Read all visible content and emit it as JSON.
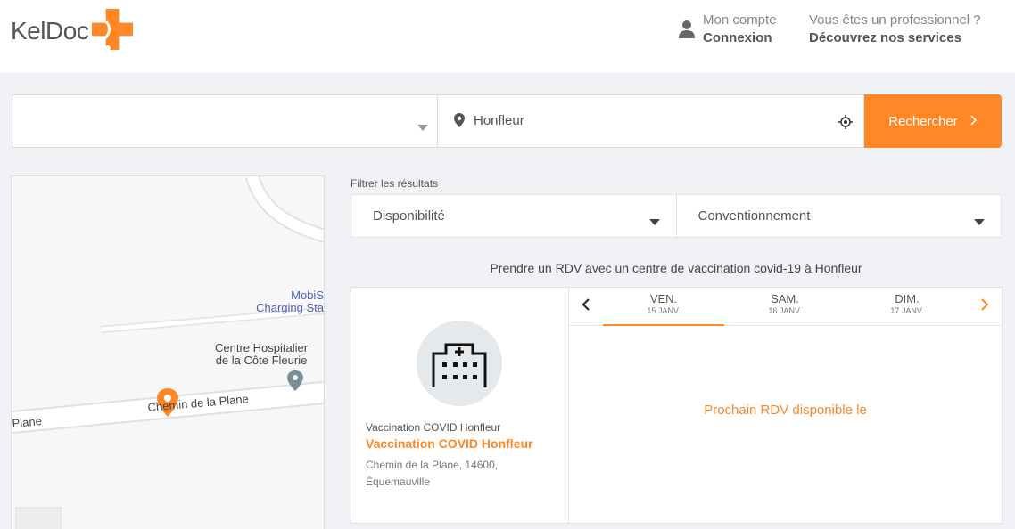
{
  "header": {
    "logo_text": "KelDoc",
    "account_line1": "Mon compte",
    "account_line2": "Connexion",
    "pro_line1": "Vous êtes un professionnel ?",
    "pro_line2": "Découvrez nos services"
  },
  "search": {
    "specialty_value": "",
    "location_value": "Honfleur",
    "button_label": "Rechercher"
  },
  "map": {
    "poi1_line1": "MobiS",
    "poi1_line2": "Charging Sta",
    "poi2_line1": "Centre Hospitalier",
    "poi2_line2": "de la Côte Fleurie",
    "road_label": "Chemin de la Plane",
    "road_label_left": "Plane"
  },
  "filters": {
    "label": "Filtrer les résultats",
    "availability": "Disponibilité",
    "convention": "Conventionnement"
  },
  "results": {
    "title": "Prendre un RDV avec un centre de vaccination covid-19 à Honfleur",
    "practitioner": {
      "category": "Vaccination COVID Honfleur",
      "name": "Vaccination COVID Honfleur",
      "address_line1": "Chemin de la Plane, 14600,",
      "address_line2": "Équemauville"
    },
    "days": [
      {
        "name": "VEN.",
        "date": "15 JANV."
      },
      {
        "name": "SAM.",
        "date": "16 JANV."
      },
      {
        "name": "DIM.",
        "date": "17 JANV."
      }
    ],
    "next_availability": "Prochain RDV disponible le"
  },
  "colors": {
    "accent": "#ff8726",
    "background": "#f0f2f5"
  }
}
